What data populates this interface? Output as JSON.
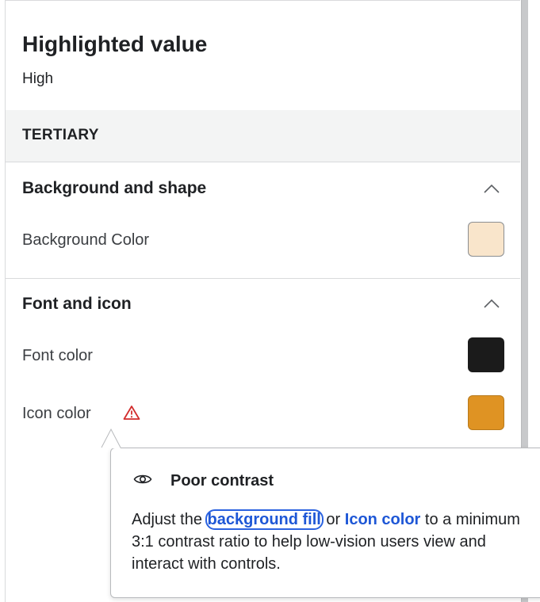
{
  "header": {
    "title": "Highlighted value",
    "subtitle": "High"
  },
  "group": {
    "label": "TERTIARY"
  },
  "sections": {
    "background": {
      "title": "Background and shape",
      "rows": [
        {
          "label": "Background Color",
          "color": "#f9e5cb"
        }
      ]
    },
    "font_icon": {
      "title": "Font and icon",
      "rows": [
        {
          "label": "Font color",
          "color": "#1b1b1b"
        },
        {
          "label": "Icon color",
          "color": "#df9323",
          "warning_icon": "warning-triangle-icon"
        }
      ]
    }
  },
  "tooltip": {
    "icon": "eye-icon",
    "title": "Poor contrast",
    "body_prefix": "Adjust the ",
    "link1": "background fill",
    "body_middle": " or ",
    "link2": "Icon color",
    "body_suffix": " to a minimum 3:1 contrast ratio to help low-vision users view and interact with controls."
  },
  "colors": {
    "warning": "#d22d2d",
    "link": "#1e57d6"
  }
}
